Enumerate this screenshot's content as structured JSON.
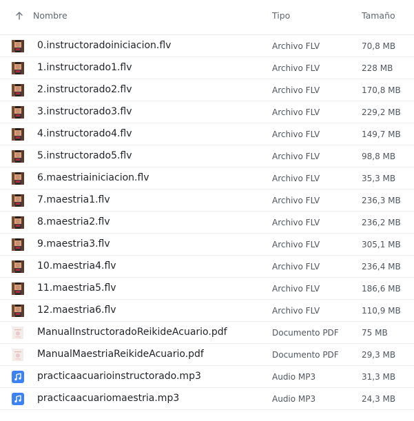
{
  "header": {
    "name_label": "Nombre",
    "type_label": "Tipo",
    "size_label": "Tamaño",
    "sort_icon": "arrow-up-icon"
  },
  "colors": {
    "audio_accent": "#3b82f6",
    "text_primary": "#1f2328",
    "text_secondary": "#4f5660"
  },
  "files": [
    {
      "name": "0.instructoradoiniciacion.flv",
      "type": "Archivo FLV",
      "size": "70,8 MB",
      "icon": "video-thumbnail-icon"
    },
    {
      "name": "1.instructorado1.flv",
      "type": "Archivo FLV",
      "size": "228 MB",
      "icon": "video-thumbnail-icon"
    },
    {
      "name": "2.instructorado2.flv",
      "type": "Archivo FLV",
      "size": "170,8 MB",
      "icon": "video-thumbnail-icon"
    },
    {
      "name": "3.instructorado3.flv",
      "type": "Archivo FLV",
      "size": "229,2 MB",
      "icon": "video-thumbnail-icon"
    },
    {
      "name": "4.instructorado4.flv",
      "type": "Archivo FLV",
      "size": "149,7 MB",
      "icon": "video-thumbnail-icon"
    },
    {
      "name": "5.instructorado5.flv",
      "type": "Archivo FLV",
      "size": "98,8 MB",
      "icon": "video-thumbnail-icon"
    },
    {
      "name": "6.maestriainiciacion.flv",
      "type": "Archivo FLV",
      "size": "35,3 MB",
      "icon": "video-thumbnail-icon"
    },
    {
      "name": "7.maestria1.flv",
      "type": "Archivo FLV",
      "size": "236,3 MB",
      "icon": "video-thumbnail-icon"
    },
    {
      "name": "8.maestria2.flv",
      "type": "Archivo FLV",
      "size": "236,2 MB",
      "icon": "video-thumbnail-icon"
    },
    {
      "name": "9.maestria3.flv",
      "type": "Archivo FLV",
      "size": "305,1 MB",
      "icon": "video-thumbnail-icon"
    },
    {
      "name": "10.maestria4.flv",
      "type": "Archivo FLV",
      "size": "236,4 MB",
      "icon": "video-thumbnail-icon"
    },
    {
      "name": "11.maestria5.flv",
      "type": "Archivo FLV",
      "size": "186,6 MB",
      "icon": "video-thumbnail-icon"
    },
    {
      "name": "12.maestria6.flv",
      "type": "Archivo FLV",
      "size": "110,9 MB",
      "icon": "video-thumbnail-icon"
    },
    {
      "name": "ManualInstructoradoReikideAcuario.pdf",
      "type": "Documento PDF",
      "size": "75 MB",
      "icon": "pdf-thumbnail-icon"
    },
    {
      "name": "ManualMaestriaReikideAcuario.pdf",
      "type": "Documento PDF",
      "size": "29,3 MB",
      "icon": "pdf-thumbnail-icon"
    },
    {
      "name": "practicaacuarioinstructorado.mp3",
      "type": "Audio MP3",
      "size": "31,3 MB",
      "icon": "music-note-icon"
    },
    {
      "name": "practicaacuariomaestria.mp3",
      "type": "Audio MP3",
      "size": "24,3 MB",
      "icon": "music-note-icon"
    }
  ]
}
